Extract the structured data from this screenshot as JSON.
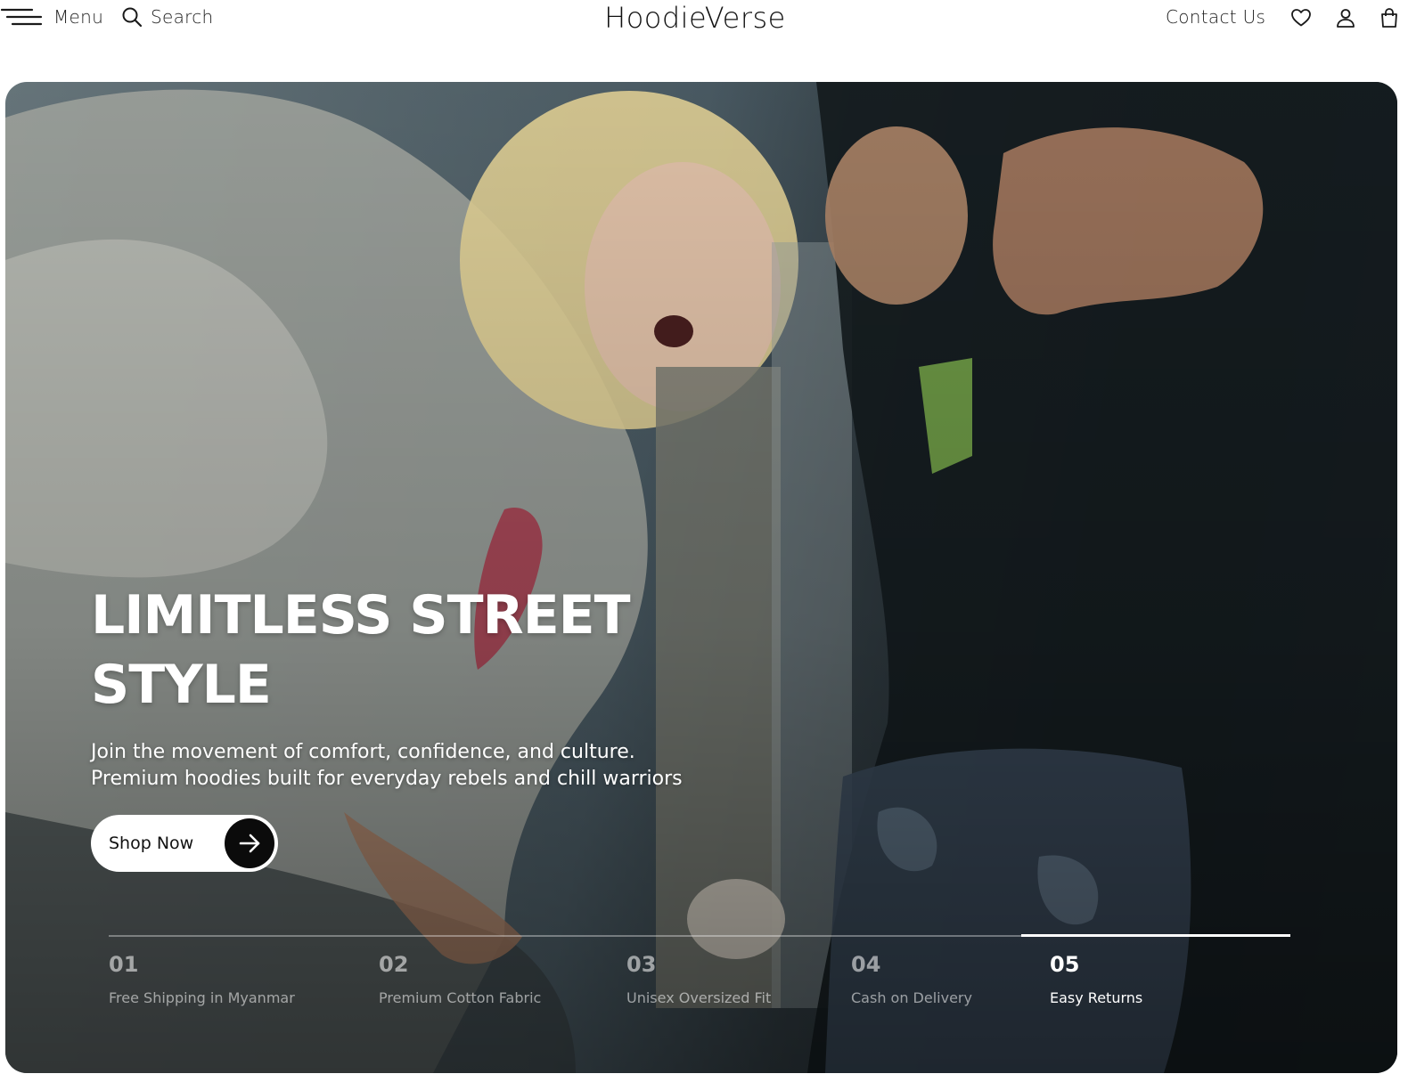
{
  "header": {
    "menu_label": "Menu",
    "search_label": "Search",
    "brand": "HoodieVerse",
    "contact_label": "Contact Us"
  },
  "icons": {
    "menu": "hamburger-icon",
    "search": "search-icon",
    "wishlist": "heart-icon",
    "account": "user-icon",
    "cart": "bag-icon",
    "cta": "arrow-right-icon"
  },
  "hero": {
    "title_line1": "LIMITLESS STREET",
    "title_line2": "STYLE",
    "subtitle_line1": "Join the movement of comfort, confidence, and culture.",
    "subtitle_line2": "Premium hoodies built for everyday rebels and chill warriors",
    "cta_label": "Shop Now"
  },
  "features": {
    "active_index": 4,
    "items": [
      {
        "number": "01",
        "label": "Free Shipping in Myanmar"
      },
      {
        "number": "02",
        "label": "Premium Cotton Fabric"
      },
      {
        "number": "03",
        "label": "Unisex Oversized Fit"
      },
      {
        "number": "04",
        "label": "Cash on Delivery"
      },
      {
        "number": "05",
        "label": "Easy Returns"
      }
    ]
  },
  "colors": {
    "background": "#ffffff",
    "text": "#1a1a1a",
    "cta_bg": "#ffffff",
    "cta_arrow_bg": "#0b0b0b",
    "hero_text": "#ffffff"
  }
}
